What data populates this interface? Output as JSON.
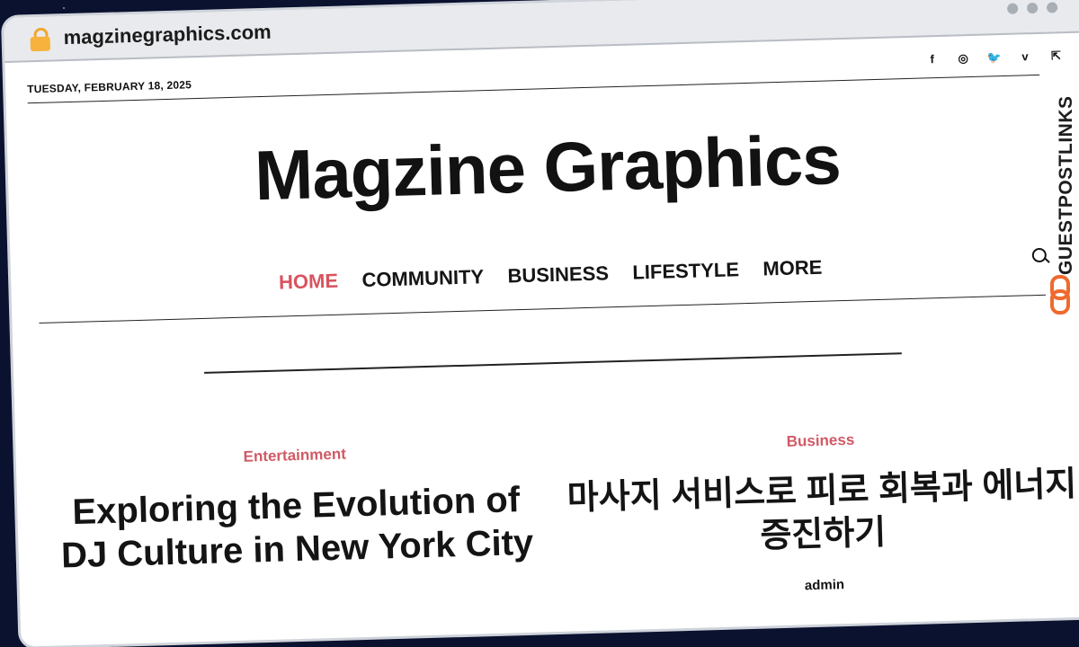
{
  "browser": {
    "url": "magzinegraphics.com"
  },
  "header": {
    "date": "TUESDAY, FEBRUARY 18, 2025",
    "social": [
      {
        "icon": "facebook-icon",
        "glyph": "f"
      },
      {
        "icon": "instagram-icon",
        "glyph": "◎"
      },
      {
        "icon": "twitter-icon",
        "glyph": "🐦"
      },
      {
        "icon": "vimeo-icon",
        "glyph": "v"
      },
      {
        "icon": "share-icon",
        "glyph": "⇱"
      }
    ]
  },
  "site": {
    "logo": "Magzine Graphics"
  },
  "nav": {
    "items": [
      "HOME",
      "COMMUNITY",
      "BUSINESS",
      "LIFESTYLE",
      "MORE"
    ],
    "active_index": 0,
    "accent": "#d9535f"
  },
  "articles": [
    {
      "category": "Entertainment",
      "title": "Exploring the Evolution of DJ Culture in New York City"
    },
    {
      "category": "Business",
      "title": "마사지 서비스로 피로 회복과 에너지 증진하기",
      "author": "admin"
    }
  ],
  "watermark": {
    "text": "GUESTPOSTLINKS",
    "accent": "#ef6a2d"
  }
}
